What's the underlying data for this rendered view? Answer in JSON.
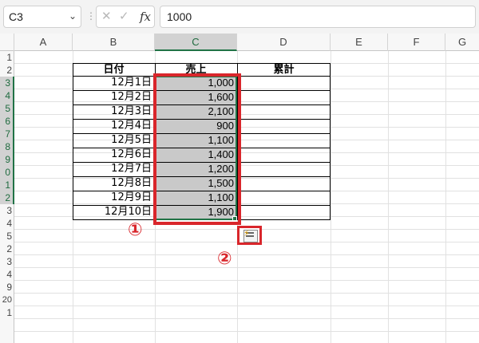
{
  "formula_bar": {
    "name_box": "C3",
    "fx_label": "fx",
    "formula_value": "1000"
  },
  "columns": [
    "A",
    "B",
    "C",
    "D",
    "E",
    "F",
    "G"
  ],
  "rows": [
    "1",
    "2",
    "3",
    "4",
    "5",
    "6",
    "7",
    "8",
    "9",
    "0",
    "1",
    "2",
    "3",
    "4",
    "5",
    "2",
    "3",
    "4",
    "9",
    "20",
    "1"
  ],
  "table": {
    "headers": [
      "日付",
      "売上",
      "累計"
    ],
    "dates": [
      "12月1日",
      "12月2日",
      "12月3日",
      "12月4日",
      "12月5日",
      "12月6日",
      "12月7日",
      "12月8日",
      "12月9日",
      "12月10日"
    ],
    "sales": [
      "1,000",
      "1,600",
      "2,100",
      "900",
      "1,100",
      "1,400",
      "1,200",
      "1,500",
      "1,100",
      "1,900"
    ]
  },
  "annotations": {
    "callout_1": "①",
    "callout_2": "②"
  },
  "colors": {
    "highlight_red": "#d9262b",
    "excel_green": "#217346",
    "selection_gray": "#c9c9c9"
  },
  "icons": {
    "quick_analysis": "quick-analysis-icon"
  }
}
